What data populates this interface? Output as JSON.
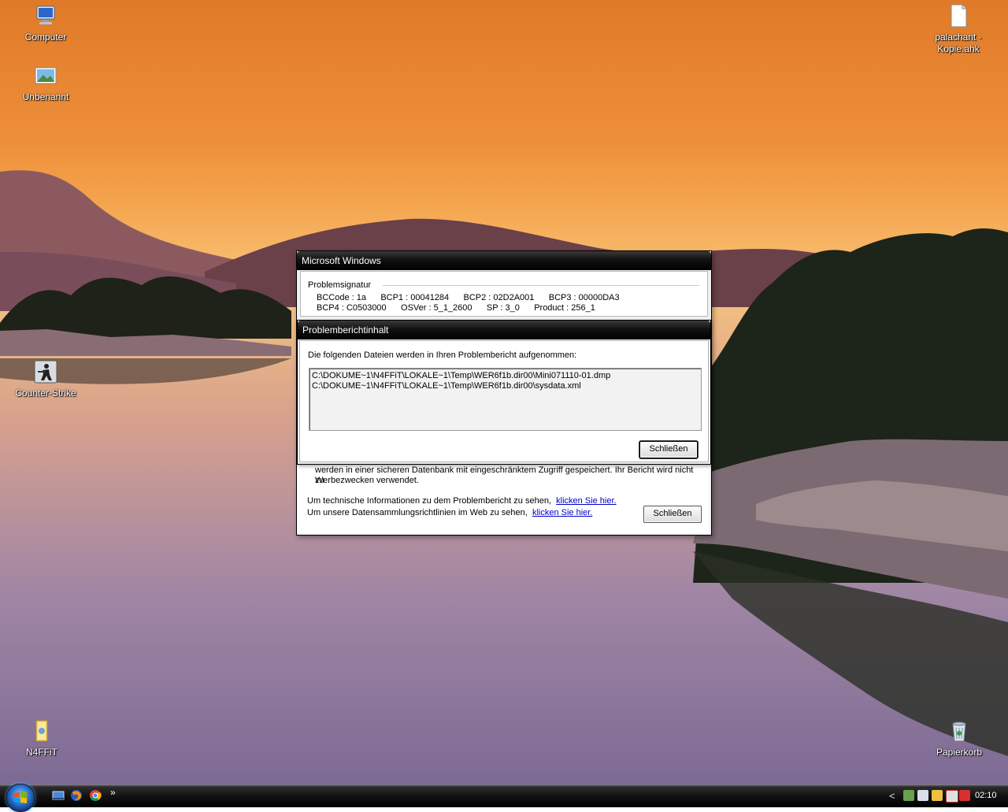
{
  "desktop": {
    "icons": [
      {
        "label": "Computer",
        "icon": "computer-icon"
      },
      {
        "label": "Unbenannt",
        "icon": "image-file-icon"
      },
      {
        "label": "Counter-Strike",
        "icon": "counter-strike-icon"
      },
      {
        "label": "N4FFiT",
        "icon": "folder-icon"
      },
      {
        "label": "palachant - Kopie.ahk",
        "icon": "document-icon"
      },
      {
        "label": "Papierkorb",
        "icon": "recycle-bin-icon"
      }
    ]
  },
  "dialog_back": {
    "title": "Microsoft Windows",
    "signature_label": "Problemsignatur",
    "signature_row1": "BCCode : 1a      BCP1 : 00041284      BCP2 : 02D2A001      BCP3 : 00000DA3",
    "signature_row2": "BCP4 : C0503000      OSVer : 5_1_2600      SP : 3_0      Product : 256_1",
    "privacy_line1": "werden in einer sicheren Datenbank mit eingeschränktem Zugriff gespeichert. Ihr Bericht wird nicht zu",
    "privacy_line2": "Werbezwecken verwendet.",
    "tech_info_text": "Um technische Informationen zu dem Problembericht zu sehen,",
    "tech_info_link": "klicken Sie hier.",
    "policy_text": "Um unsere Datensammlungsrichtlinien im Web zu sehen,",
    "policy_link": "klicken Sie hier.",
    "close_button": "Schließen"
  },
  "dialog_front": {
    "title": "Problemberichtinhalt",
    "message": "Die folgenden Dateien werden in Ihren Problembericht aufgenommen:",
    "files": [
      "C:\\DOKUME~1\\N4FFiT\\LOKALE~1\\Temp\\WER6f1b.dir00\\Mini071110-01.dmp",
      "C:\\DOKUME~1\\N4FFiT\\LOKALE~1\\Temp\\WER6f1b.dir00\\sysdata.xml"
    ],
    "close_button": "Schließen"
  },
  "taskbar": {
    "quick_launch": [
      "show-desktop-icon",
      "firefox-icon",
      "chrome-icon"
    ],
    "overflow": "»",
    "tray_expand": "<",
    "tray_icons": [
      "shield-icon",
      "network-icon",
      "people-icon",
      "security-alert-icon",
      "antivirus-icon"
    ],
    "clock": "02:10"
  }
}
